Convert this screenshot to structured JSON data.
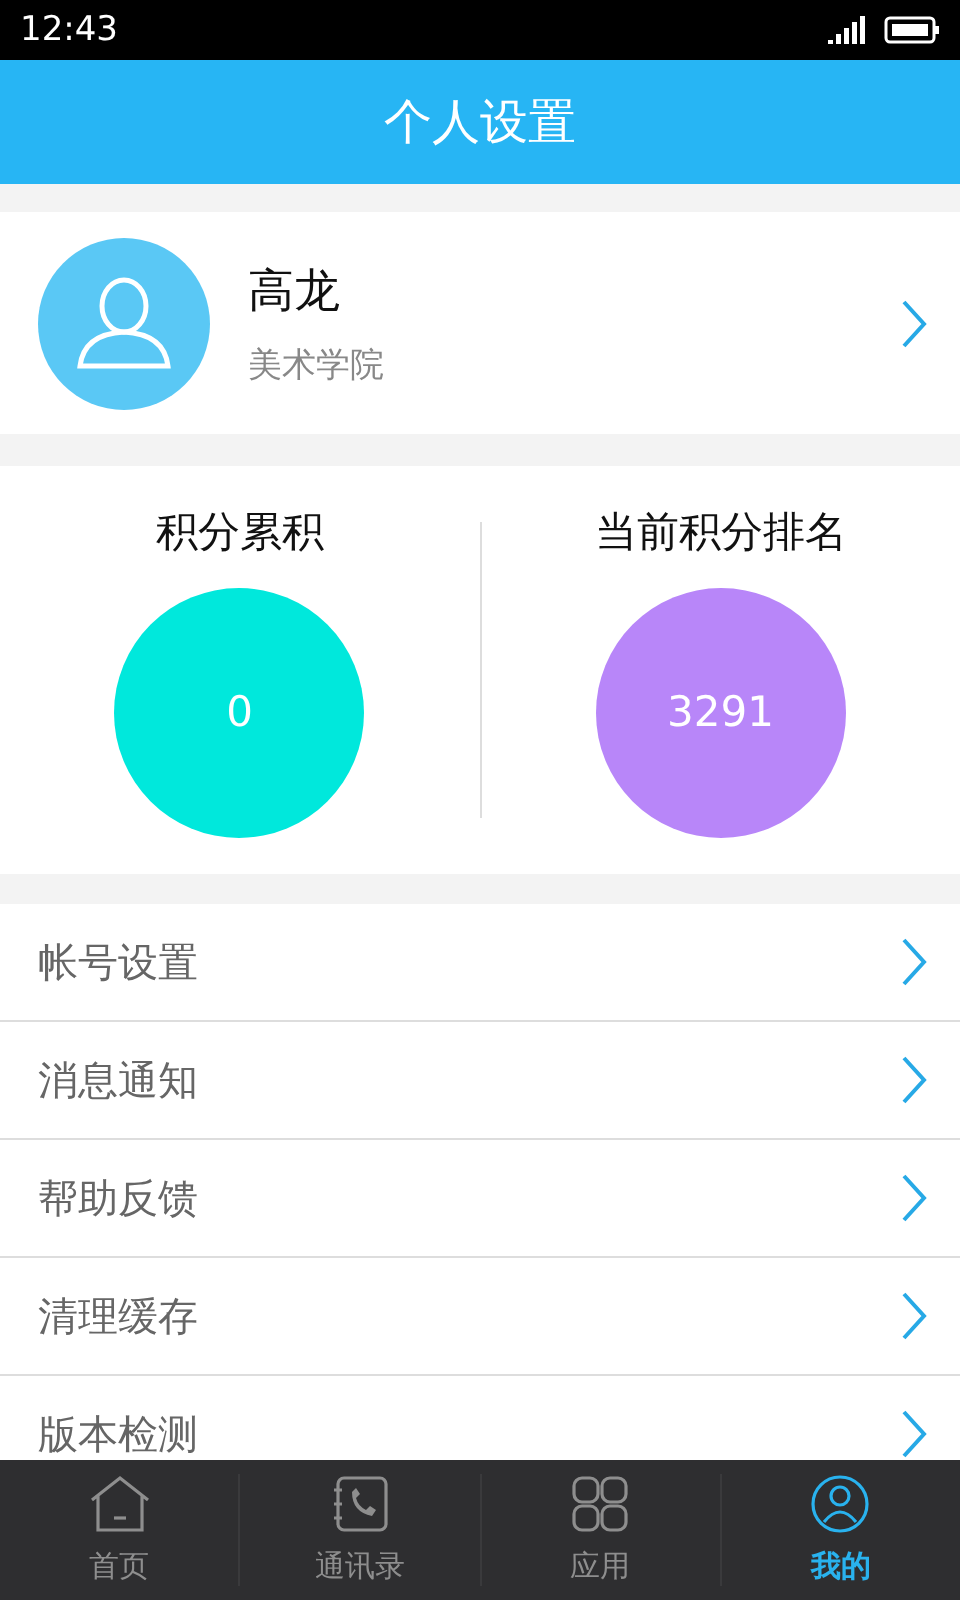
{
  "status_bar": {
    "time": "12:43"
  },
  "header": {
    "title": "个人设置"
  },
  "profile": {
    "name": "高龙",
    "subtitle": "美术学院"
  },
  "stats": [
    {
      "label": "积分累积",
      "value": "0",
      "color": "#00e8dc"
    },
    {
      "label": "当前积分排名",
      "value": "3291",
      "color": "#b886f9"
    }
  ],
  "menu": [
    {
      "label": "帐号设置"
    },
    {
      "label": "消息通知"
    },
    {
      "label": "帮助反馈"
    },
    {
      "label": "清理缓存"
    },
    {
      "label": "版本检测"
    }
  ],
  "tabs": [
    {
      "label": "首页",
      "kind": "home",
      "selected": false
    },
    {
      "label": "通讯录",
      "kind": "contacts",
      "selected": false
    },
    {
      "label": "应用",
      "kind": "apps",
      "selected": false
    },
    {
      "label": "我的",
      "kind": "me",
      "selected": true
    }
  ]
}
